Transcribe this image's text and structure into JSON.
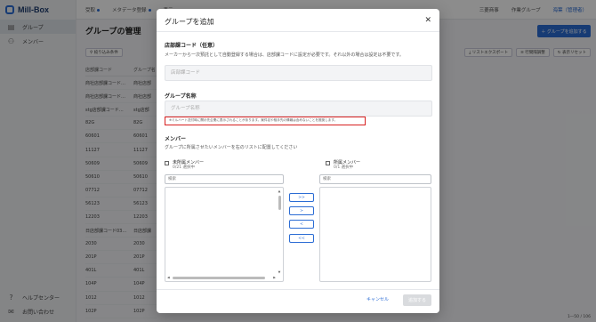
{
  "app": {
    "brand": "Mill-Box",
    "nav": [
      {
        "label": "グループ",
        "icon": "folder-icon"
      },
      {
        "label": "メンバー",
        "icon": "users-icon"
      }
    ],
    "footer_nav": [
      {
        "label": "ヘルプセンター",
        "icon": "help-icon"
      },
      {
        "label": "お問い合わせ",
        "icon": "mail-icon"
      }
    ]
  },
  "topbar": {
    "items": [
      "受取",
      "メタデータ登録",
      "表示"
    ],
    "company": "三菱商事",
    "group": "作業グループ",
    "user": "海葉（管理者）"
  },
  "page": {
    "title": "グループの管理",
    "primary_button": "＋ グループを追加する",
    "filter_button": "絞り込み条件",
    "toolbar_right": [
      "リストエクスポート",
      "行間隔調整",
      "表示リセット"
    ],
    "table": {
      "headers": [
        "店部課コード",
        "グループ名"
      ],
      "rows": [
        [
          "商社店部課コード…",
          "商社店部"
        ],
        [
          "商社店部課コード…",
          "商社店部"
        ],
        [
          "stg店部課コード…",
          "stg店部"
        ],
        [
          "82G",
          "82G"
        ],
        [
          "60601",
          "60601"
        ],
        [
          "11127",
          "11127"
        ],
        [
          "50609",
          "50609"
        ],
        [
          "50610",
          "50610"
        ],
        [
          "07712",
          "07712"
        ],
        [
          "56123",
          "56123"
        ],
        [
          "12203",
          "12203"
        ],
        [
          "日店部課コード03…",
          "日店部課"
        ],
        [
          "2030",
          "2030"
        ],
        [
          "201P",
          "201P"
        ],
        [
          "401L",
          "401L"
        ],
        [
          "104P",
          "104P"
        ],
        [
          "1012",
          "1012"
        ],
        [
          "102P",
          "102P"
        ]
      ]
    },
    "pager": "1―50 / 106"
  },
  "modal": {
    "title": "グループを追加",
    "dept_code": {
      "label": "店部課コード（任意）",
      "desc": "メーカーから一次預託として自動登録する場合は、店部課コードに設定が必要です。それ以外の場合は設定は不要です。",
      "placeholder": "店部課コード",
      "value": ""
    },
    "group_name": {
      "label": "グループ名称",
      "placeholder": "グループ名称",
      "value": "",
      "warning": "※ミルハート送付時に開示先企業に表示されることがあります。案件名や相手先の情報は含めないことを推奨します。"
    },
    "members": {
      "label": "メンバー",
      "desc": "グループに所属させたいメンバーを右のリストに配置してください",
      "left": {
        "label": "未所属メンバー",
        "count": "0/21 選択中",
        "search_placeholder": "検索"
      },
      "right": {
        "label": "所属メンバー",
        "count": "0/1 選択中",
        "search_placeholder": "検索"
      },
      "buttons": [
        ">>",
        ">",
        "<",
        "<<"
      ]
    },
    "cancel": "キャンセル",
    "submit": "追加する"
  },
  "colors": {
    "primary": "#2b6cd4",
    "warning_border": "#d72020",
    "disabled": "#d9dbde"
  }
}
